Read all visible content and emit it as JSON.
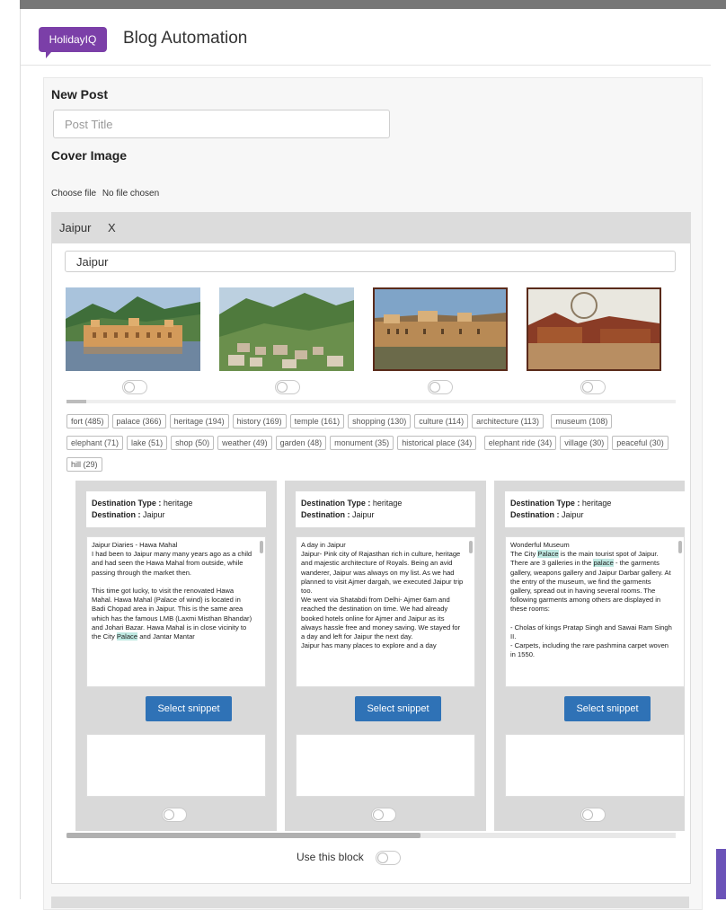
{
  "app": {
    "logo_text": "HolidayIQ",
    "title": "Blog Automation",
    "brand_color": "#7b3fa8",
    "button_color": "#2f72b6"
  },
  "form": {
    "new_post_label": "New Post",
    "title_placeholder": "Post Title",
    "cover_label": "Cover Image",
    "choose_file_label": "Choose file",
    "no_file_text": "No file chosen"
  },
  "destination": {
    "name": "Jaipur",
    "remove_label": "X",
    "search_value": "Jaipur",
    "images": [
      {
        "name": "jal-mahal-image",
        "selected": false
      },
      {
        "name": "jaipur-hills-image",
        "selected": false
      },
      {
        "name": "amer-fort-image",
        "selected": false
      },
      {
        "name": "village-image",
        "selected": false
      }
    ],
    "tags": [
      "fort (485)",
      "palace (366)",
      "heritage (194)",
      "history (169)",
      "temple (161)",
      "shopping (130)",
      "culture (114)",
      "architecture (113)",
      "museum (108)",
      "elephant (71)",
      "lake (51)",
      "shop (50)",
      "weather (49)",
      "garden (48)",
      "monument (35)",
      "historical place (34)",
      "elephant ride (34)",
      "village (30)",
      "peaceful (30)",
      "hill (29)"
    ],
    "snippets": [
      {
        "type_label": "Destination Type :",
        "type_value": "heritage",
        "dest_label": "Destination :",
        "dest_value": "Jaipur",
        "text_before": "Jaipur Diaries - Hawa Mahal\nI had been to Jaipur many many years ago as a child and had seen the Hawa Mahal from outside, while passing through the market then.\n\nThis time got lucky, to visit the renovated Hawa Mahal. Hawa Mahal (Palace of wind) is located in Badi Chopad area in Jaipur. This is the same area which has the famous LMB (Laxmi Misthan Bhandar) and Johari Bazar. Hawa Mahal is in close vicinity to the City ",
        "highlight": "Palace",
        "text_after": " and Jantar Mantar",
        "button_label": "Select snippet"
      },
      {
        "type_label": "Destination Type :",
        "type_value": "heritage",
        "dest_label": "Destination :",
        "dest_value": "Jaipur",
        "text_before": "A day in Jaipur\nJaipur- Pink city of Rajasthan rich in culture, heritage and majestic architecture of Royals. Being an avid wanderer, Jaipur was always on my list. As we had planned to visit Ajmer dargah, we executed Jaipur trip too.\nWe went via Shatabdi from Delhi- Ajmer 6am and reached the destination on time. We had already booked hotels online for Ajmer and Jaipur as its always hassle free and money saving. We stayed for a day and left for Jaipur the next day.\nJaipur has many places to explore and a day",
        "highlight": "",
        "text_after": "",
        "button_label": "Select snippet"
      },
      {
        "type_label": "Destination Type :",
        "type_value": "heritage",
        "dest_label": "Destination :",
        "dest_value": "Jaipur",
        "text_before": "Wonderful Museum\nThe City ",
        "highlight": "Palace",
        "text_mid": " is the main tourist spot of Jaipur. There are 3 galleries in the ",
        "highlight2": "palace",
        "text_after": " - the garments gallery, weapons gallery and Jaipur Darbar gallery. At the entry of the museum, we find the garments gallery, spread out in having several rooms. The following garments among others are displayed in these rooms:\n\n- Cholas of kings Pratap Singh and Sawai Ram Singh II.\n- Carpets, including the rare pashmina carpet woven in 1550.",
        "button_label": "Select snippet"
      }
    ],
    "use_block_label": "Use this block"
  }
}
